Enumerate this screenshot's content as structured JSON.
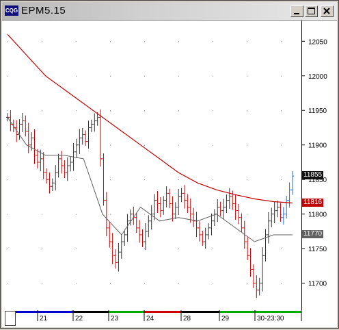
{
  "window": {
    "title": "EPM5.15",
    "app_icon_label": "CQG"
  },
  "price_axis": {
    "labels": [
      "12050",
      "12000",
      "11950",
      "11900",
      "11850",
      "11800",
      "11750",
      "11700"
    ],
    "current_price": "11855",
    "ma_red_value": "11816",
    "ma_gray_value": "11770"
  },
  "time_axis": {
    "labels": [
      "21",
      "22",
      "23",
      "24",
      "28",
      "29",
      "30-23:30"
    ]
  },
  "colors": {
    "bar_up": "#303030",
    "bar_down": "#cc0000",
    "bar_last": "#1e6fd0",
    "ma_long": "#c00000",
    "ma_short": "#606060",
    "session_colors": [
      "#0000cc",
      "#000000",
      "#00aa00",
      "#cc0000",
      "#000000",
      "#00aa00",
      "#00aa00"
    ]
  },
  "chart_data": {
    "type": "bar",
    "title": "EPM5.15",
    "xlabel": "",
    "ylabel": "",
    "ylim": [
      11660,
      12080
    ],
    "sessions": [
      "21",
      "22",
      "23",
      "24",
      "28",
      "29",
      "30-23:30"
    ],
    "series": [
      {
        "name": "EPM5.15",
        "closes": [
          11940,
          11930,
          11925,
          11915,
          11930,
          11935,
          11920,
          11900,
          11910,
          11885,
          11875,
          11880,
          11860,
          11850,
          11840,
          11845,
          11860,
          11880,
          11870,
          11860,
          11870,
          11875,
          11890,
          11900,
          11910,
          11915,
          11905,
          11925,
          11930,
          11935,
          11940,
          11880,
          11820,
          11780,
          11760,
          11740,
          11730,
          11745,
          11760,
          11770,
          11790,
          11800,
          11795,
          11780,
          11770,
          11760,
          11775,
          11790,
          11800,
          11820,
          11815,
          11805,
          11820,
          11830,
          11815,
          11800,
          11810,
          11825,
          11830,
          11820,
          11810,
          11800,
          11790,
          11780,
          11770,
          11760,
          11770,
          11780,
          11790,
          11800,
          11810,
          11805,
          11810,
          11820,
          11825,
          11815,
          11805,
          11795,
          11780,
          11760,
          11740,
          11720,
          11700,
          11690,
          11700,
          11740,
          11770,
          11790,
          11800,
          11805,
          11810,
          11795,
          11800,
          11820,
          11835,
          11855
        ]
      },
      {
        "name": "",
        "type": "line",
        "values": [
          12060,
          12030,
          12000,
          11980,
          11960,
          11940,
          11920,
          11900,
          11880,
          11860,
          11845,
          11835,
          11828,
          11822,
          11818,
          11816
        ]
      },
      {
        "name": "",
        "type": "line",
        "values": [
          11940,
          11900,
          11885,
          11885,
          11880,
          11800,
          11770,
          11810,
          11790,
          11795,
          11790,
          11800,
          11780,
          11760,
          11770,
          11770
        ]
      }
    ]
  }
}
